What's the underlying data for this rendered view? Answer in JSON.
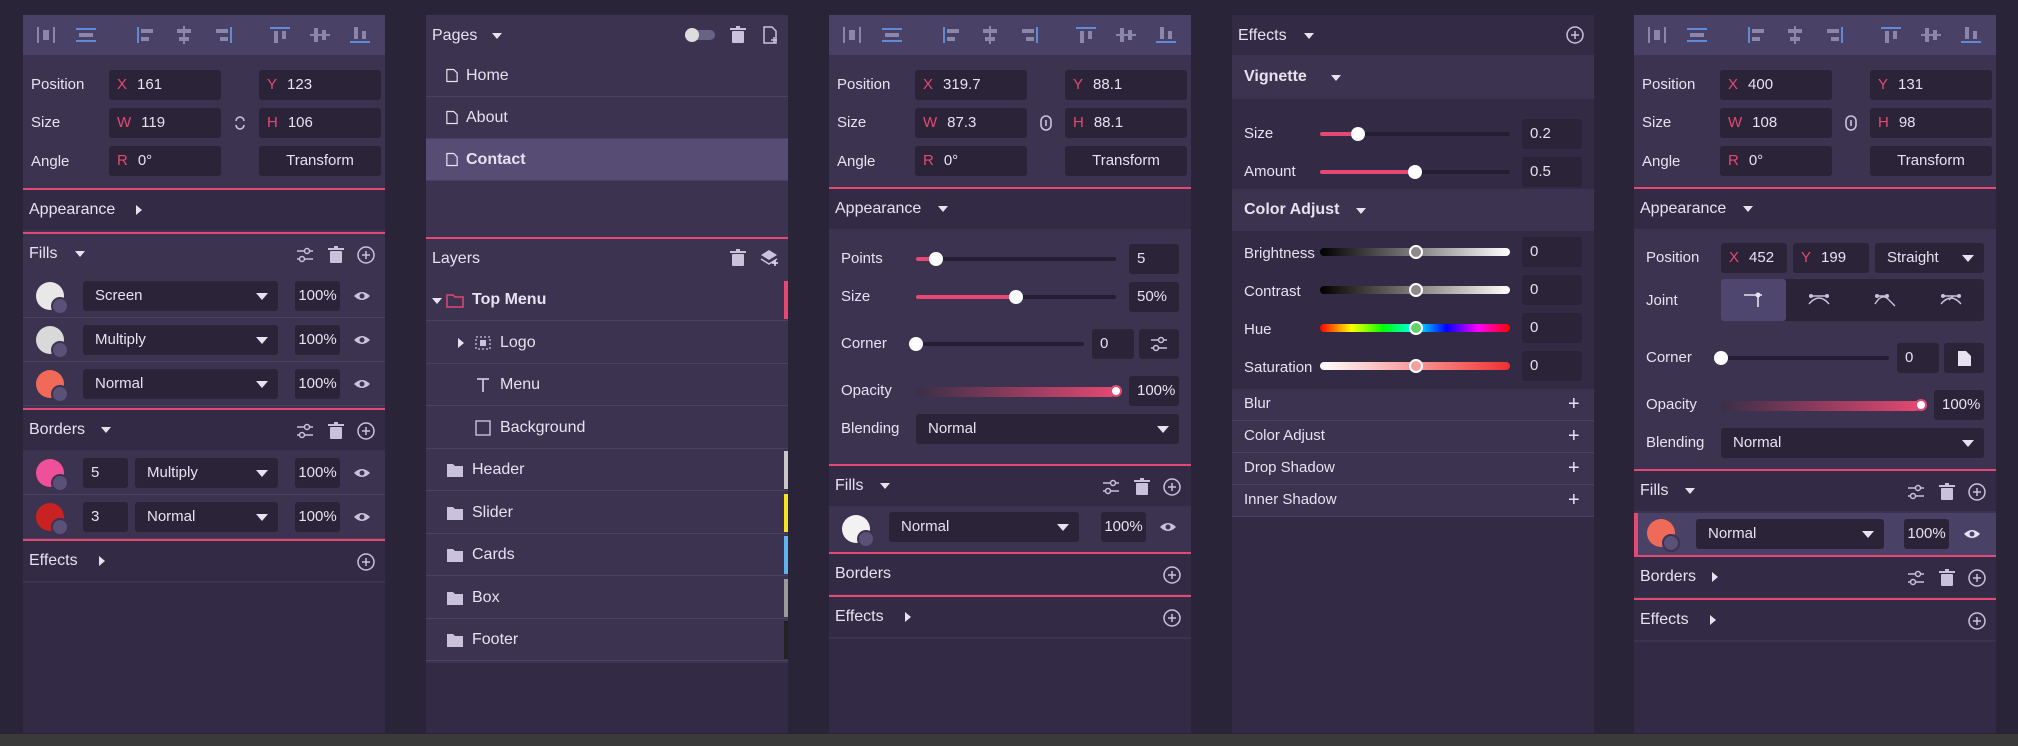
{
  "panel1": {
    "position_label": "Position",
    "size_label": "Size",
    "angle_label": "Angle",
    "x_prefix": "X",
    "x_value": "161",
    "y_prefix": "Y",
    "y_value": "123",
    "w_prefix": "W",
    "w_value": "119",
    "h_prefix": "H",
    "h_value": "106",
    "r_prefix": "R",
    "r_value": "0°",
    "transform_label": "Transform",
    "appearance_label": "Appearance",
    "fills_label": "Fills",
    "fills": [
      {
        "mode": "Screen",
        "opacity": "100%",
        "color": "#e8e8e8"
      },
      {
        "mode": "Multiply",
        "opacity": "100%",
        "color": "#d9d9d9"
      },
      {
        "mode": "Normal",
        "opacity": "100%",
        "color": "#f06a5a"
      }
    ],
    "borders_label": "Borders",
    "borders": [
      {
        "width": "5",
        "mode": "Multiply",
        "opacity": "100%",
        "color": "#f0509a"
      },
      {
        "width": "3",
        "mode": "Normal",
        "opacity": "100%",
        "color": "#c92222"
      }
    ],
    "effects_label": "Effects"
  },
  "panel2": {
    "pages_label": "Pages",
    "pages": [
      "Home",
      "About",
      "Contact"
    ],
    "layers_label": "Layers",
    "layers": [
      {
        "name": "Top Menu",
        "color": "#e54872"
      },
      {
        "name": "Logo",
        "color": ""
      },
      {
        "name": "Menu",
        "color": ""
      },
      {
        "name": "Background",
        "color": ""
      },
      {
        "name": "Header",
        "color": "#c8c8c8"
      },
      {
        "name": "Slider",
        "color": "#f5e32a"
      },
      {
        "name": "Cards",
        "color": "#5fb4f0"
      },
      {
        "name": "Box",
        "color": "#9a9a9a"
      },
      {
        "name": "Footer",
        "color": "#222222"
      }
    ]
  },
  "panel3": {
    "position_label": "Position",
    "size_label": "Size",
    "angle_label": "Angle",
    "x_prefix": "X",
    "x_value": "319.7",
    "y_prefix": "Y",
    "y_value": "88.1",
    "w_prefix": "W",
    "w_value": "87.3",
    "h_prefix": "H",
    "h_value": "88.1",
    "r_prefix": "R",
    "r_value": "0°",
    "transform_label": "Transform",
    "appearance_label": "Appearance",
    "points_label": "Points",
    "points_value": "5",
    "points_level": 0.1,
    "size2_label": "Size",
    "size2_value": "50%",
    "size2_level": 0.5,
    "corner_label": "Corner",
    "corner_value": "0",
    "corner_level": 0,
    "opacity_label": "Opacity",
    "opacity_value": "100%",
    "opacity_level": 1,
    "blending_label": "Blending",
    "blending_value": "Normal",
    "fills_label": "Fills",
    "fill_mode": "Normal",
    "fill_opacity": "100%",
    "fill_color": "#f2f2f2",
    "borders_label": "Borders",
    "effects_label": "Effects"
  },
  "panel4": {
    "effects_label": "Effects",
    "vignette_label": "Vignette",
    "size_label": "Size",
    "size_value": "0.2",
    "size_level": 0.2,
    "amount_label": "Amount",
    "amount_value": "0.5",
    "amount_level": 0.5,
    "coloradjust_label": "Color Adjust",
    "brightness_label": "Brightness",
    "brightness_value": "0",
    "contrast_label": "Contrast",
    "contrast_value": "0",
    "hue_label": "Hue",
    "hue_value": "0",
    "saturation_label": "Saturation",
    "saturation_value": "0",
    "add_items": [
      "Blur",
      "Color Adjust",
      "Drop Shadow",
      "Inner Shadow"
    ]
  },
  "panel5": {
    "position_label": "Position",
    "size_label": "Size",
    "angle_label": "Angle",
    "x_prefix": "X",
    "x_value": "400",
    "y_prefix": "Y",
    "y_value": "131",
    "w_prefix": "W",
    "w_value": "108",
    "h_prefix": "H",
    "h_value": "98",
    "r_prefix": "R",
    "r_value": "0°",
    "transform_label": "Transform",
    "appearance_label": "Appearance",
    "pos2_label": "Position",
    "x2_value": "452",
    "y2_value": "199",
    "curve_type": "Straight",
    "joint_label": "Joint",
    "corner_label": "Corner",
    "corner_value": "0",
    "corner_level": 0,
    "opacity_label": "Opacity",
    "opacity_value": "100%",
    "opacity_level": 1,
    "blending_label": "Blending",
    "blending_value": "Normal",
    "fills_label": "Fills",
    "fill_mode": "Normal",
    "fill_opacity": "100%",
    "fill_color": "#f06a5a",
    "borders_label": "Borders",
    "effects_label": "Effects"
  },
  "colors": {
    "accent": "#e54872",
    "panel": "#3b3350",
    "field": "#2b2439",
    "toolbar": "#4a4166"
  }
}
